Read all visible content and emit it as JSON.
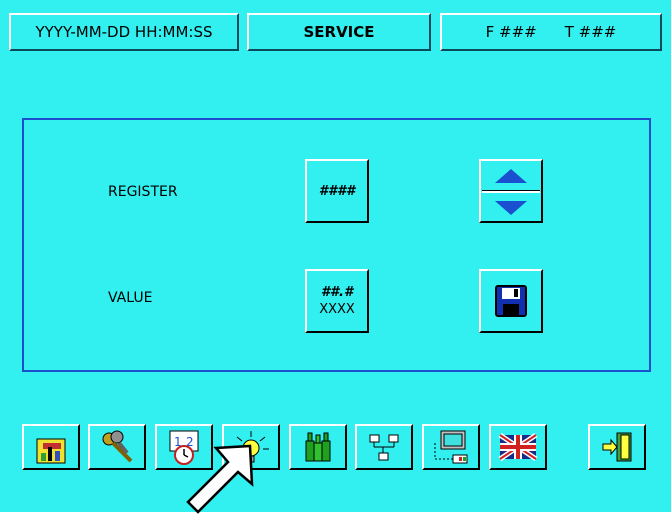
{
  "header": {
    "datetime": "YYYY-MM-DD HH:MM:SS",
    "title": "SERVICE",
    "f_label": "F ###",
    "t_label": "T ###"
  },
  "panel": {
    "register_label": "REGISTER",
    "register_value": "####",
    "value_label": "VALUE",
    "value_line1": "##.#",
    "value_line2": "XXXX"
  },
  "toolbar": {
    "icons": [
      "tools-icon",
      "keys-icon",
      "calendar-clock-icon",
      "lightbulb-icon",
      "bottles-icon",
      "network-icon",
      "computer-icon",
      "uk-flag-icon",
      "exit-door-icon"
    ]
  },
  "colors": {
    "background": "#33f0f0",
    "accent": "#1a4fd0"
  }
}
